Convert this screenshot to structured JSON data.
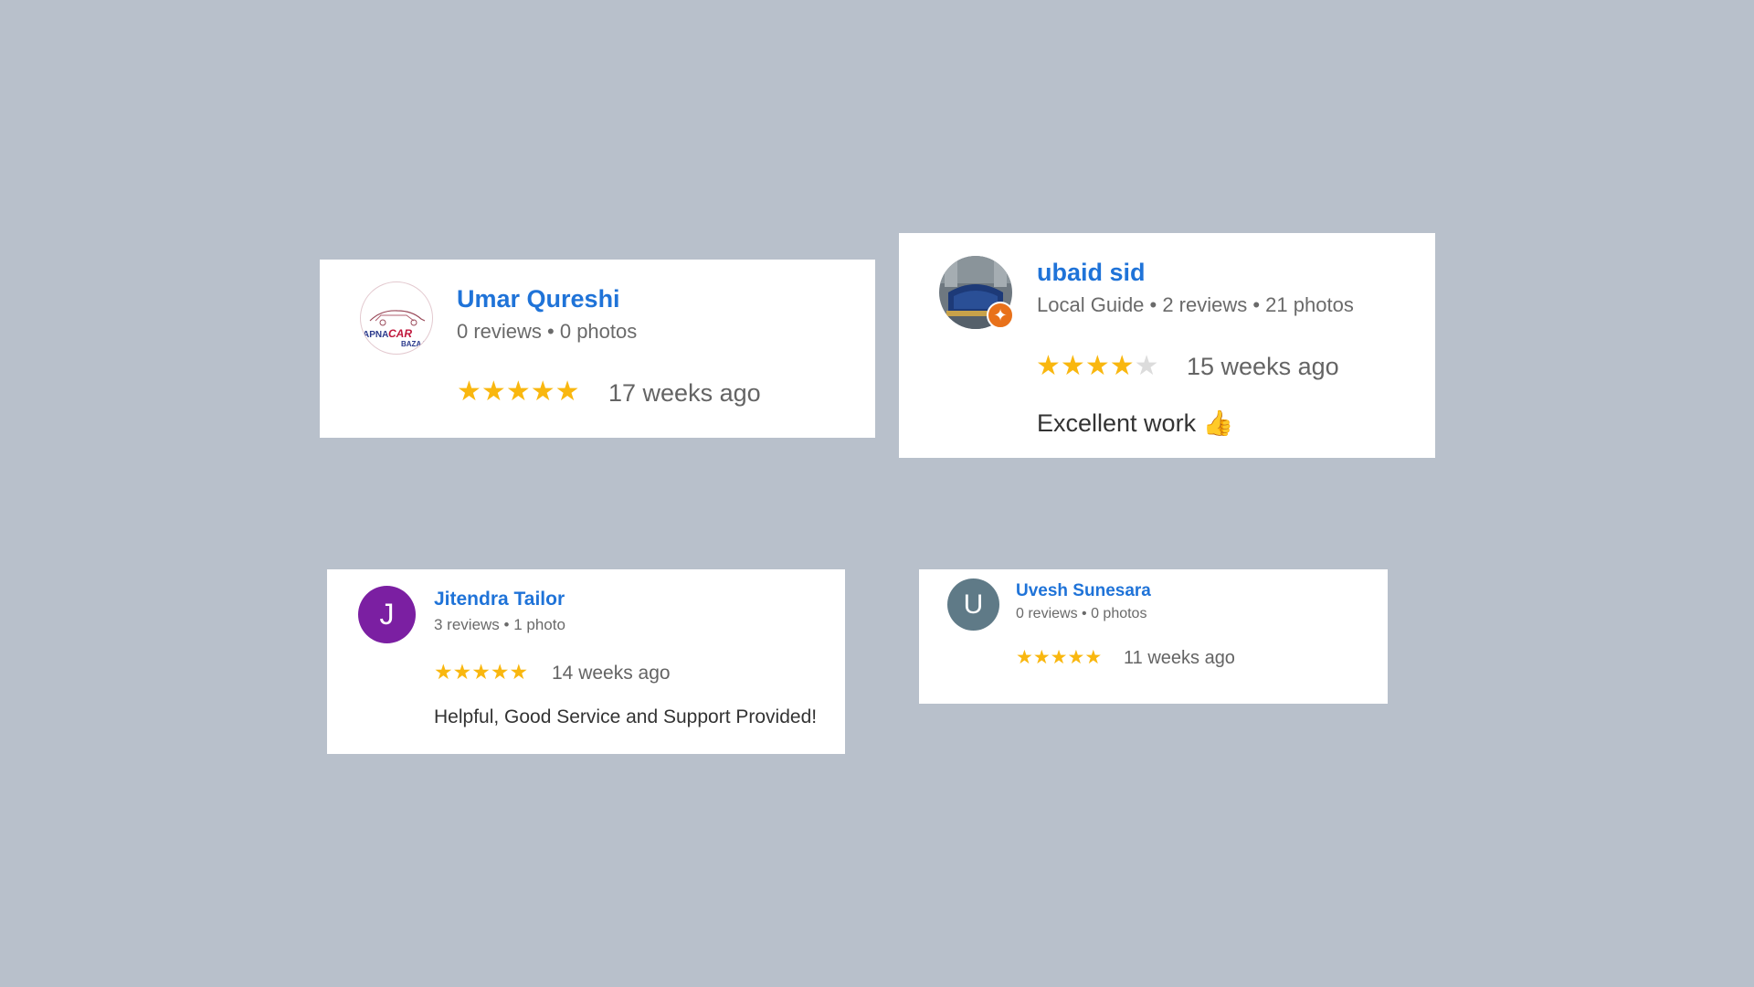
{
  "reviews": [
    {
      "name": "Umar Qureshi",
      "meta": "0 reviews • 0 photos",
      "rating": 5,
      "time": "17 weeks ago",
      "avatar": {
        "type": "logo",
        "logo_text": "APNA CAR BAZAAR"
      }
    },
    {
      "name": "ubaid sid",
      "meta": "Local Guide • 2 reviews • 21 photos",
      "rating": 4,
      "time": "15 weeks ago",
      "text": "Excellent work 👍",
      "avatar": {
        "type": "photo",
        "badge": "local-guide-badge"
      }
    },
    {
      "name": "Jitendra Tailor",
      "meta": "3 reviews • 1 photo",
      "rating": 5,
      "time": "14 weeks ago",
      "text": "Helpful, Good Service and Support Provided!",
      "avatar": {
        "type": "letter",
        "letter": "J",
        "color": "#7b1fa2"
      }
    },
    {
      "name": "Uvesh Sunesara",
      "meta": "0 reviews • 0 photos",
      "rating": 5,
      "time": "11 weeks ago",
      "avatar": {
        "type": "letter",
        "letter": "U",
        "color": "#5f7a87"
      }
    }
  ],
  "colors": {
    "background": "#b8c0cb",
    "name": "#1f73d8",
    "star": "#f9b70f",
    "star_off": "#dcdcdc"
  }
}
